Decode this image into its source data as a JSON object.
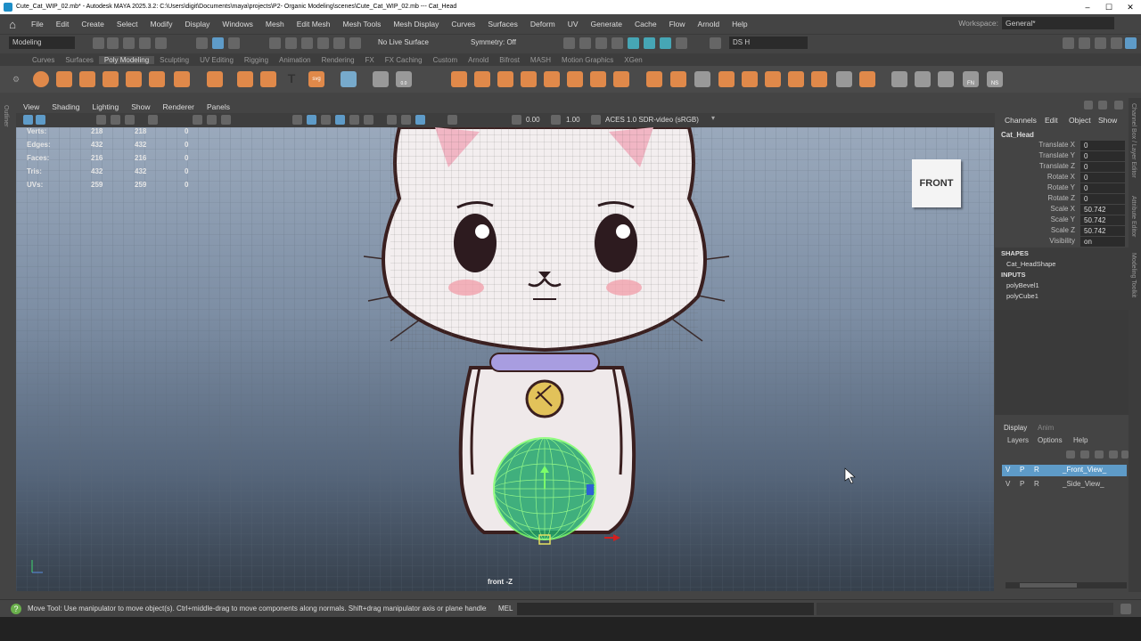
{
  "window": {
    "title": "Cute_Cat_WIP_02.mb* - Autodesk MAYA 2025.3.2: C:\\Users\\digit\\Documents\\maya\\projects\\P2- Organic Modeling\\scenes\\Cute_Cat_WIP_02.mb  ---  Cat_Head",
    "minimize": "–",
    "maximize": "☐",
    "close": "✕"
  },
  "menu": [
    "File",
    "Edit",
    "Create",
    "Select",
    "Modify",
    "Display",
    "Windows",
    "Mesh",
    "Edit Mesh",
    "Mesh Tools",
    "Mesh Display",
    "Curves",
    "Surfaces",
    "Deform",
    "UV",
    "Generate",
    "Cache",
    "Flow",
    "Arnold",
    "Help"
  ],
  "workspace": {
    "label": "Workspace:",
    "value": "General*"
  },
  "statusline": {
    "mode": "Modeling",
    "live_surface": "No Live Surface",
    "symmetry": "Symmetry: Off",
    "user": "DS H"
  },
  "shelf_tabs": [
    "Curves",
    "Surfaces",
    "Poly Modeling",
    "Sculpting",
    "UV Editing",
    "Rigging",
    "Animation",
    "Rendering",
    "FX",
    "FX Caching",
    "Custom",
    "Arnold",
    "Bifrost",
    "MASH",
    "Motion Graphics",
    "XGen"
  ],
  "shelf_active": "Poly Modeling",
  "shelf_labels": {
    "fn": "FN",
    "ns": "NS",
    "svg": "svg",
    "uv": "0.0"
  },
  "outliner_label": "Outliner",
  "viewport": {
    "menus": [
      "View",
      "Shading",
      "Lighting",
      "Show",
      "Renderer",
      "Panels"
    ],
    "exposure": "0.00",
    "gamma": "1.00",
    "colorspace": "ACES 1.0 SDR-video (sRGB)",
    "hud": {
      "rows": [
        {
          "label": "Verts:",
          "a": "218",
          "b": "218",
          "c": "0"
        },
        {
          "label": "Edges:",
          "a": "432",
          "b": "432",
          "c": "0"
        },
        {
          "label": "Faces:",
          "a": "216",
          "b": "216",
          "c": "0"
        },
        {
          "label": "Tris:",
          "a": "432",
          "b": "432",
          "c": "0"
        },
        {
          "label": "UVs:",
          "a": "259",
          "b": "259",
          "c": "0"
        }
      ]
    },
    "view_cube": "FRONT",
    "camera": "front -Z"
  },
  "channel_box": {
    "tabs": [
      "Channels",
      "Edit",
      "Object",
      "Show"
    ],
    "object": "Cat_Head",
    "channels": [
      {
        "label": "Translate X",
        "value": "0"
      },
      {
        "label": "Translate Y",
        "value": "0"
      },
      {
        "label": "Translate Z",
        "value": "0"
      },
      {
        "label": "Rotate X",
        "value": "0"
      },
      {
        "label": "Rotate Y",
        "value": "0"
      },
      {
        "label": "Rotate Z",
        "value": "0"
      },
      {
        "label": "Scale X",
        "value": "50.742"
      },
      {
        "label": "Scale Y",
        "value": "50.742"
      },
      {
        "label": "Scale Z",
        "value": "50.742"
      },
      {
        "label": "Visibility",
        "value": "on"
      }
    ],
    "shapes_header": "SHAPES",
    "shape": "Cat_HeadShape",
    "inputs_header": "INPUTS",
    "inputs": [
      "polyBevel1",
      "polyCube1"
    ]
  },
  "layer_editor": {
    "tabs": [
      "Display",
      "Anim"
    ],
    "menus": [
      "Layers",
      "Options",
      "Help"
    ],
    "layers": [
      {
        "v": "V",
        "p": "P",
        "r": "R",
        "name": "_Front_View_",
        "selected": true
      },
      {
        "v": "V",
        "p": "P",
        "r": "R",
        "name": "_Side_View_",
        "selected": false
      }
    ]
  },
  "side_tabs": [
    "Channel Box / Layer Editor",
    "Attribute Editor",
    "Modeling Toolkit"
  ],
  "help_line": "Move Tool: Use manipulator to move object(s). Ctrl+middle-drag to move components along normals. Shift+drag manipulator axis or plane handles to ext",
  "command_line": {
    "lang": "MEL"
  },
  "colors": {
    "accent": "#5e9bc8",
    "shelf_orange": "#e0894a",
    "selected_layer": "#5e9bc8"
  }
}
